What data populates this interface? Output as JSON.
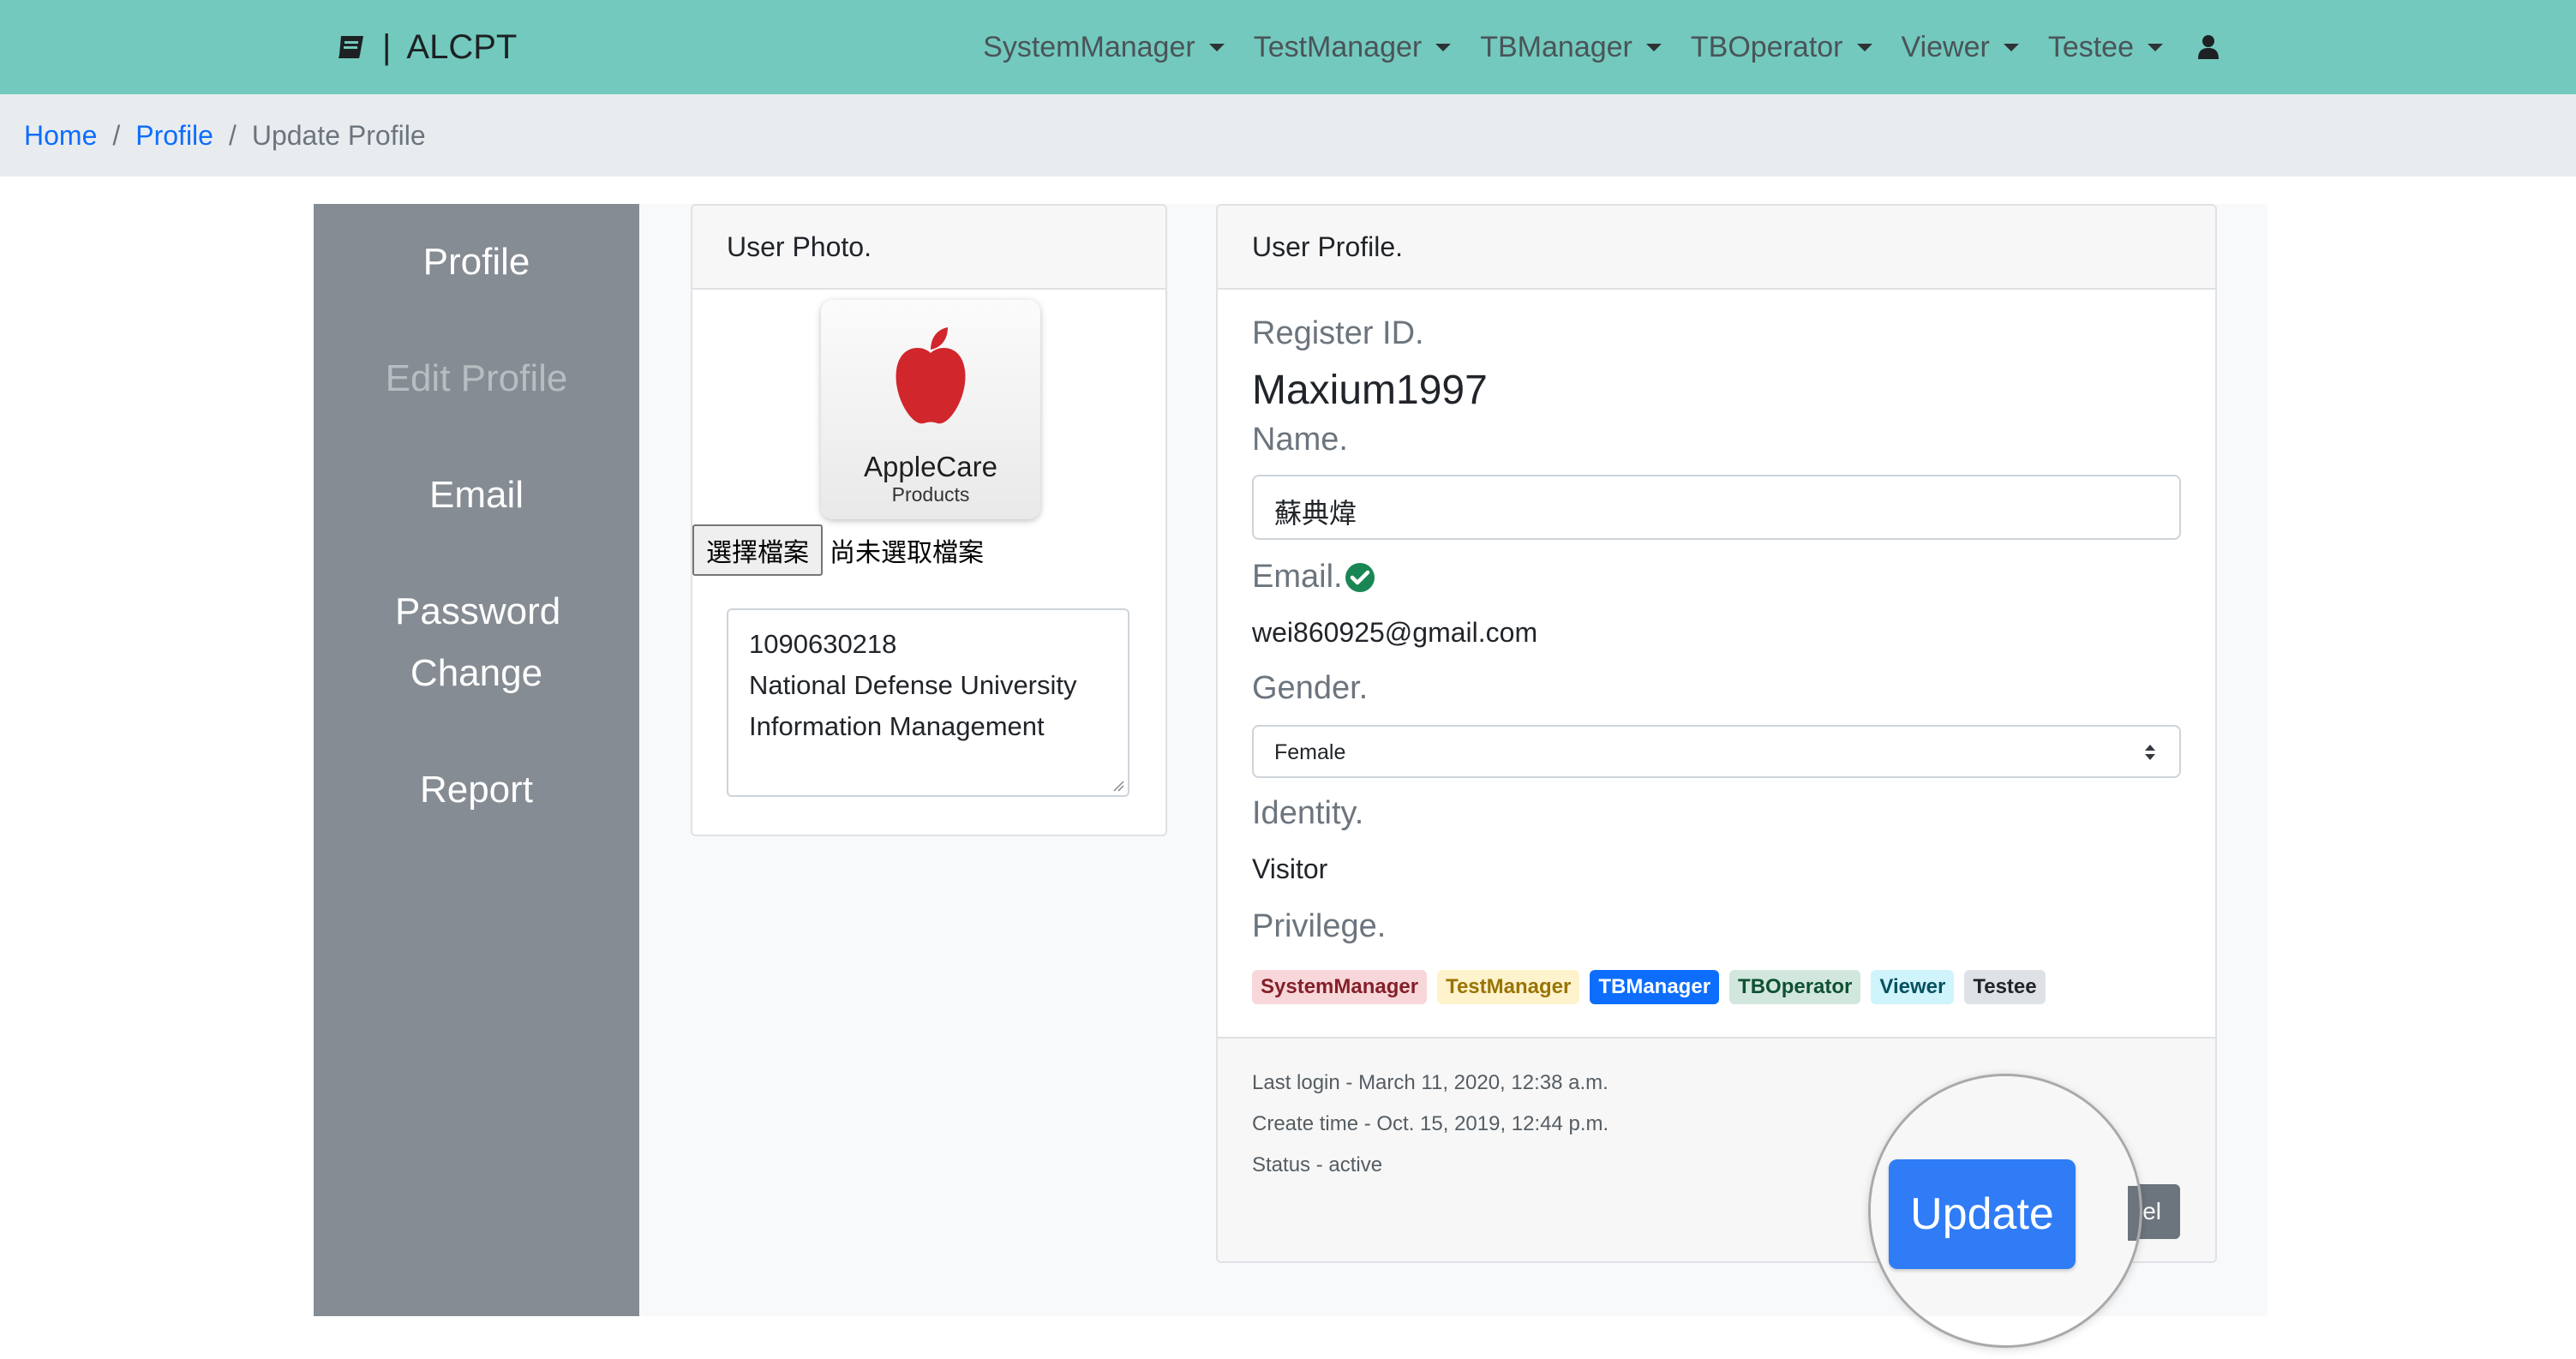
{
  "navbar": {
    "brand": "ALCPT",
    "separator": "|",
    "menus": [
      "SystemManager",
      "TestManager",
      "TBManager",
      "TBOperator",
      "Viewer",
      "Testee"
    ],
    "icons": {
      "brand": "book-icon",
      "user": "user-icon",
      "dropdown": "caret-down-icon"
    }
  },
  "breadcrumb": {
    "home": "Home",
    "profile": "Profile",
    "current": "Update Profile",
    "divider": "/"
  },
  "sidebar": {
    "items": [
      {
        "label": "Profile",
        "disabled": false
      },
      {
        "label": "Edit Profile",
        "disabled": true
      },
      {
        "label": "Email",
        "disabled": false
      },
      {
        "label": "Password Change",
        "disabled": false
      },
      {
        "label": "Report",
        "disabled": false
      }
    ]
  },
  "photo_card": {
    "title": "User Photo.",
    "photo": {
      "line1": "AppleCare",
      "line2": "Products"
    },
    "file_button": "選擇檔案",
    "file_status": "尚未選取檔案",
    "bio_lines": [
      "1090630218",
      "National Defense University",
      "Information Management"
    ]
  },
  "profile_card": {
    "title": "User Profile.",
    "register_id_label": "Register ID.",
    "register_id": "Maxium1997",
    "name_label": "Name.",
    "name_value": "蘇典煒",
    "email_label": "Email.",
    "email_value": "wei860925@gmail.com",
    "gender_label": "Gender.",
    "gender_value": "Female",
    "identity_label": "Identity.",
    "identity_value": "Visitor",
    "privilege_label": "Privilege.",
    "privileges": [
      {
        "name": "SystemManager",
        "bg": "#f8d7da",
        "fg": "#842029"
      },
      {
        "name": "TestManager",
        "bg": "#fff3cd",
        "fg": "#997404"
      },
      {
        "name": "TBManager",
        "bg": "#0d6efd",
        "fg": "#ffffff"
      },
      {
        "name": "TBOperator",
        "bg": "#d1e7dd",
        "fg": "#0f5132"
      },
      {
        "name": "Viewer",
        "bg": "#cff4fc",
        "fg": "#055160"
      },
      {
        "name": "Testee",
        "bg": "#dee2e6",
        "fg": "#212529"
      }
    ],
    "last_login": "Last login - March 11, 2020, 12:38 a.m.",
    "create_time": "Create time - Oct. 15, 2019, 12:44 p.m.",
    "status": "Status - active",
    "update_button": "Update",
    "cancel_button_visible": "el"
  },
  "colors": {
    "navbar": "#73c9bd",
    "sidebar": "#868c93",
    "primary": "#2f7cf6",
    "success": "#198754"
  }
}
